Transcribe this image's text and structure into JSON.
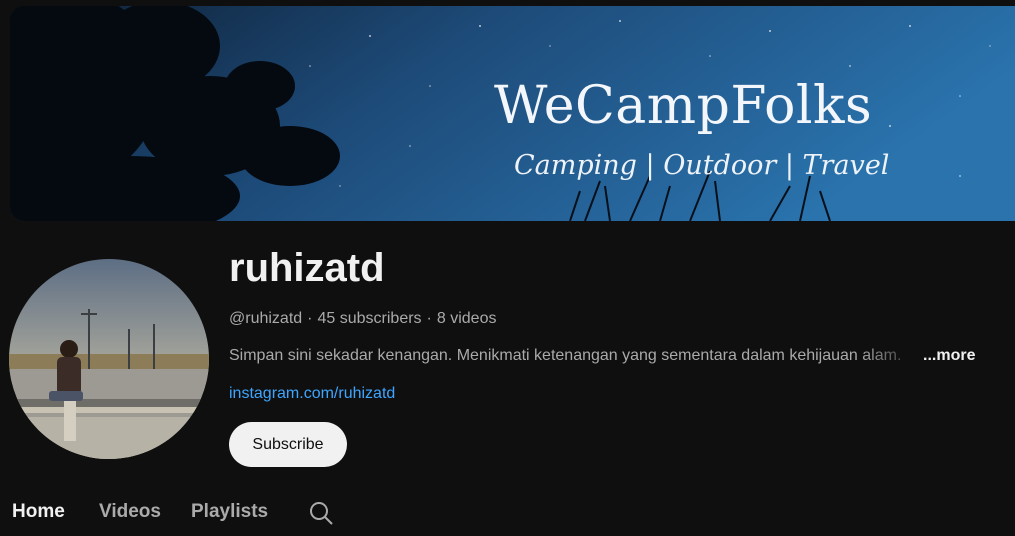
{
  "banner": {
    "title": "WeCampFolks",
    "subtitle": "Camping | Outdoor | Travel"
  },
  "channel": {
    "name": "ruhizatd",
    "handle": "@ruhizatd",
    "subscribers": "45 subscribers",
    "videos": "8 videos",
    "description": "Simpan sini sekadar kenangan. Menikmati ketenangan yang sementara dalam kehijauan alam.",
    "more_label": "...more",
    "link": "instagram.com/ruhizatd",
    "subscribe_label": "Subscribe"
  },
  "tabs": [
    {
      "label": "Home",
      "active": true
    },
    {
      "label": "Videos",
      "active": false
    },
    {
      "label": "Playlists",
      "active": false
    }
  ],
  "icons": {
    "tab_search": "search-icon"
  },
  "colors": {
    "background": "#0f0f0f",
    "link": "#3ea6ff",
    "subscribe_bg": "#f1f1f1",
    "muted_text": "#aaaaaa"
  }
}
